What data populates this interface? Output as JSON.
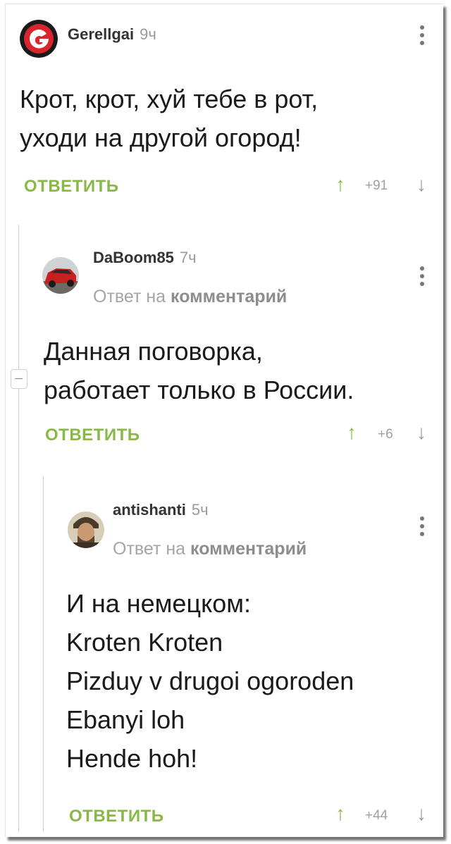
{
  "comments": [
    {
      "author": "Gerellgai",
      "time": "9ч",
      "lines": [
        "Крот, крот, хуй тебе в рот,",
        "уходи на другой огород!"
      ],
      "reply_label": "ОТВЕТИТЬ",
      "votes": "+91"
    },
    {
      "author": "DaBoom85",
      "time": "7ч",
      "reply_note_prefix": "Ответ на",
      "reply_note_link": "комментарий",
      "lines": [
        "Данная поговорка,",
        "работает только в России."
      ],
      "reply_label": "ОТВЕТИТЬ",
      "votes": "+6"
    },
    {
      "author": "antishanti",
      "time": "5ч",
      "reply_note_prefix": "Ответ на",
      "reply_note_link": "комментарий",
      "lines": [
        "И на немецком:",
        "Kroten Kroten",
        "Pizduy v drugoi ogoroden",
        "Ebanyi loh",
        "Hende hoh!"
      ],
      "reply_label": "ОТВЕТИТЬ",
      "votes": "+44"
    }
  ],
  "icons": {
    "upvote": "upvote-arrow-icon",
    "downvote": "downvote-arrow-icon",
    "menu": "more-vertical-icon",
    "collapse": "collapse-thread-icon"
  },
  "colors": {
    "accent_green": "#8ab846",
    "muted_gray": "#a5a5a5"
  },
  "glyphs": {
    "up": "↑",
    "down": "↓"
  }
}
